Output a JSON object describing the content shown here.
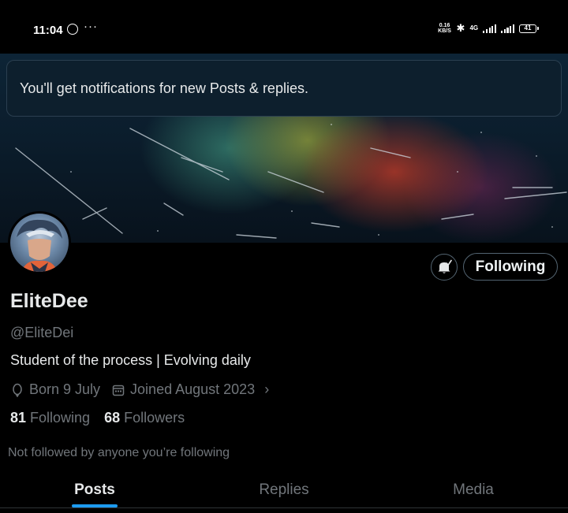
{
  "status_bar": {
    "time": "11:04",
    "more": "···",
    "net_speed": "0.16",
    "net_unit": "KB/S",
    "network": "4G",
    "battery": "41"
  },
  "toast": {
    "message": "You'll get notifications for new Posts & replies."
  },
  "profile": {
    "display_name": "EliteDee",
    "handle": "@EliteDei",
    "bio": "Student of the process | Evolving daily",
    "born": "Born 9 July",
    "joined": "Joined August 2023",
    "following_count": "81",
    "following_label": "Following",
    "followers_count": "68",
    "followers_label": "Followers",
    "not_followed": "Not followed by anyone you’re following"
  },
  "actions": {
    "follow_state": "Following",
    "bell_icon": "bell-icon"
  },
  "tabs": [
    {
      "label": "Posts",
      "active": true
    },
    {
      "label": "Replies",
      "active": false
    },
    {
      "label": "Media",
      "active": false
    }
  ],
  "colors": {
    "accent": "#1d9bf0",
    "muted": "#71767b",
    "text": "#e7e9ea",
    "background": "#000000"
  }
}
